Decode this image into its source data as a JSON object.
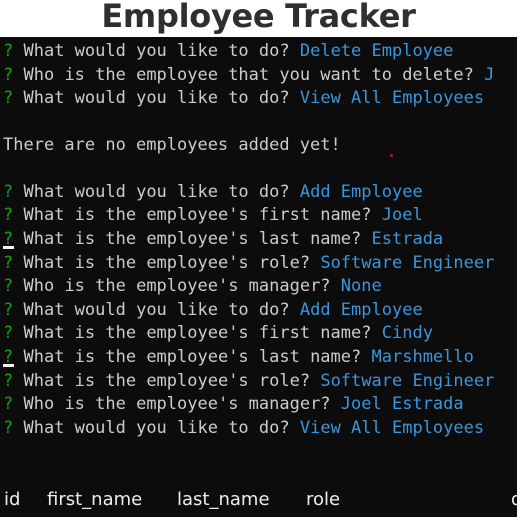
{
  "window": {
    "title": "Employee Tracker"
  },
  "terminal": {
    "prompt_mark": "?",
    "lines": [
      {
        "question": "What would you like to do?",
        "answer": "Delete Employee"
      },
      {
        "question": "Who is the employee that you want to delete?",
        "answer": "J"
      },
      {
        "question": "What would you like to do?",
        "answer": "View All Employees"
      },
      {
        "message": "There are no employees added yet!"
      },
      {
        "question": "What would you like to do?",
        "answer": "Add Employee"
      },
      {
        "question": "What is the employee's first name?",
        "answer": "Joel"
      },
      {
        "question": "What is the employee's last name?",
        "answer": "Estrada"
      },
      {
        "question": "What is the employee's role?",
        "answer": "Software Engineer"
      },
      {
        "question": "Who is the employee's manager?",
        "answer": "None"
      },
      {
        "question": "What would you like to do?",
        "answer": "Add Employee"
      },
      {
        "question": "What is the employee's first name?",
        "answer": "Cindy"
      },
      {
        "question": "What is the employee's last name?",
        "answer": "Marshmello"
      },
      {
        "question": "What is the employee's role?",
        "answer": "Software Engineer"
      },
      {
        "question": "Who is the employee's manager?",
        "answer": "Joel Estrada"
      },
      {
        "question": "What would you like to do?",
        "answer": "View All Employees"
      }
    ],
    "table_headers": [
      "id",
      "first_name",
      "last_name",
      "role",
      "d"
    ]
  },
  "colors": {
    "terminal_background": "#0c0c0c",
    "text": "#cccccc",
    "prompt_mark": "#13a10e",
    "answer": "#3a96dd",
    "title": "#2f2f2f"
  }
}
